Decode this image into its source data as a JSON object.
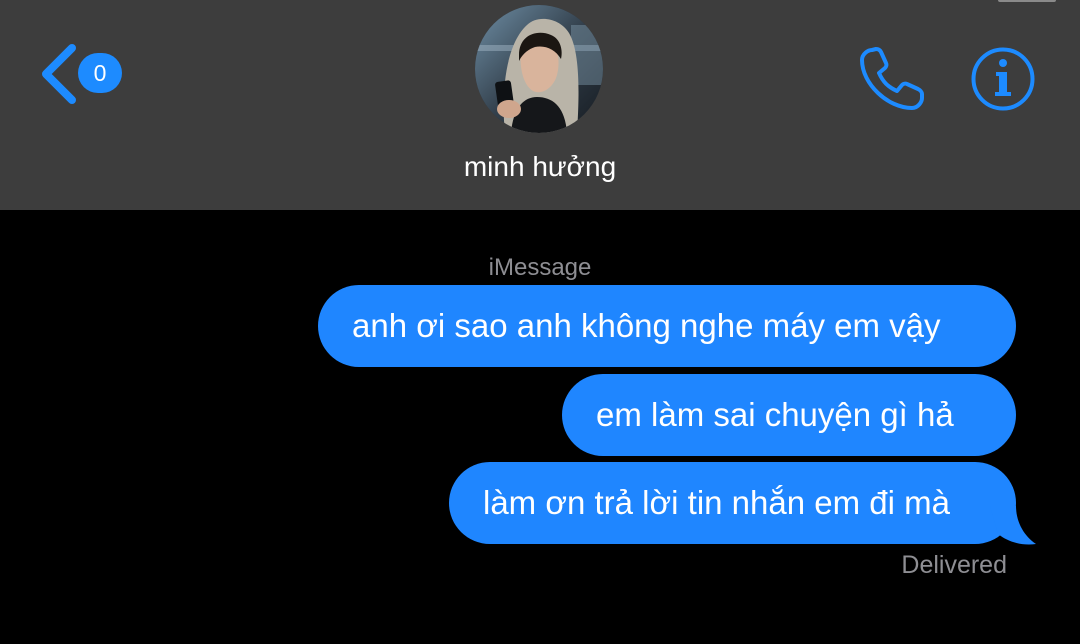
{
  "header": {
    "back_badge": "0",
    "contact_name": "minh hưởng",
    "accent_color": "#1d8bff",
    "background_color": "#3d3d3d"
  },
  "thread": {
    "service_label": "iMessage",
    "messages": [
      {
        "text": "anh ơi sao anh không nghe máy em vậy",
        "direction": "outgoing"
      },
      {
        "text": "em làm sai chuyện gì hả",
        "direction": "outgoing"
      },
      {
        "text": "làm ơn trả lời tin nhắn em đi mà",
        "direction": "outgoing"
      }
    ],
    "status": "Delivered",
    "bubble_color": "#1f86ff"
  },
  "icons": {
    "back": "chevron-left-icon",
    "call": "phone-icon",
    "info": "info-icon"
  }
}
